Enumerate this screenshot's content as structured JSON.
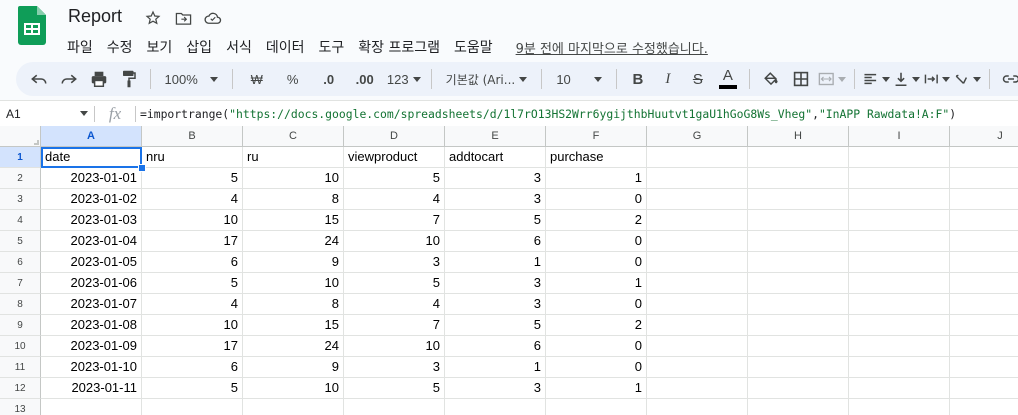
{
  "header": {
    "title": "Report",
    "menus": [
      "파일",
      "수정",
      "보기",
      "삽입",
      "서식",
      "데이터",
      "도구",
      "확장 프로그램",
      "도움말"
    ],
    "last_edit": "9분 전에 마지막으로 수정했습니다."
  },
  "toolbar": {
    "zoom": "100%",
    "currency": "₩",
    "percent": "%",
    "decrease_decimal": ".0",
    "increase_decimal": ".00",
    "number_format": "123",
    "font": "기본값 (Ari...",
    "font_size": "10",
    "bold": "B",
    "italic": "I",
    "strike": "S",
    "text_color_glyph": "A"
  },
  "formula_bar": {
    "cell_ref": "A1",
    "fx": "fx",
    "formula_prefix": "=importrange(",
    "formula_arg1": "\"https://docs.google.com/spreadsheets/d/1l7rO13HS2Wrr6ygijthbHuutvt1gaU1hGoG8Ws_Vheg\"",
    "formula_comma": ",",
    "formula_arg2": "\"InAPP Rawdata!A:F\"",
    "formula_suffix": ")"
  },
  "grid": {
    "columns": [
      "A",
      "B",
      "C",
      "D",
      "E",
      "F",
      "G",
      "H",
      "I",
      "J"
    ],
    "row_numbers": [
      "1",
      "2",
      "3",
      "4",
      "5",
      "6",
      "7",
      "8",
      "9",
      "10",
      "11",
      "12",
      "13"
    ],
    "headers": [
      "date",
      "nru",
      "ru",
      "viewproduct",
      "addtocart",
      "purchase"
    ],
    "rows": [
      [
        "2023-01-01",
        "5",
        "10",
        "5",
        "3",
        "1"
      ],
      [
        "2023-01-02",
        "4",
        "8",
        "4",
        "3",
        "0"
      ],
      [
        "2023-01-03",
        "10",
        "15",
        "7",
        "5",
        "2"
      ],
      [
        "2023-01-04",
        "17",
        "24",
        "10",
        "6",
        "0"
      ],
      [
        "2023-01-05",
        "6",
        "9",
        "3",
        "1",
        "0"
      ],
      [
        "2023-01-06",
        "5",
        "10",
        "5",
        "3",
        "1"
      ],
      [
        "2023-01-07",
        "4",
        "8",
        "4",
        "3",
        "0"
      ],
      [
        "2023-01-08",
        "10",
        "15",
        "7",
        "5",
        "2"
      ],
      [
        "2023-01-09",
        "17",
        "24",
        "10",
        "6",
        "0"
      ],
      [
        "2023-01-10",
        "6",
        "9",
        "3",
        "1",
        "0"
      ],
      [
        "2023-01-11",
        "5",
        "10",
        "5",
        "3",
        "1"
      ]
    ]
  },
  "colors": {
    "accent": "#1a73e8",
    "logo_green": "#0f9d58",
    "formula_string": "#137333"
  }
}
